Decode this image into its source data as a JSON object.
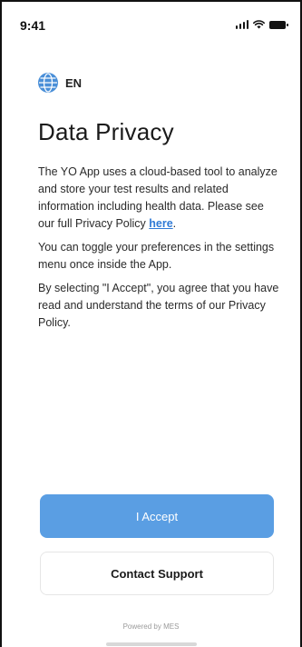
{
  "status_bar": {
    "time": "9:41"
  },
  "language": {
    "code": "EN",
    "icon": "globe-icon"
  },
  "page": {
    "title": "Data Privacy"
  },
  "content": {
    "paragraph1_prefix": "The YO App uses a cloud-based tool to analyze and store your test results and related information including health data. Please see our full Privacy Policy ",
    "paragraph1_link": "here",
    "paragraph1_suffix": ".",
    "paragraph2": "You can toggle your preferences in the settings menu once inside the App.",
    "paragraph3": "By selecting \"I Accept\", you agree that you have read and understand the terms of our Privacy Policy."
  },
  "actions": {
    "accept_label": "I Accept",
    "support_label": "Contact Support"
  },
  "footer": {
    "powered_by": "Powered by MES"
  },
  "colors": {
    "accent": "#5a9ee3",
    "link": "#2f7ad6",
    "globe": "#4a8fd8"
  }
}
